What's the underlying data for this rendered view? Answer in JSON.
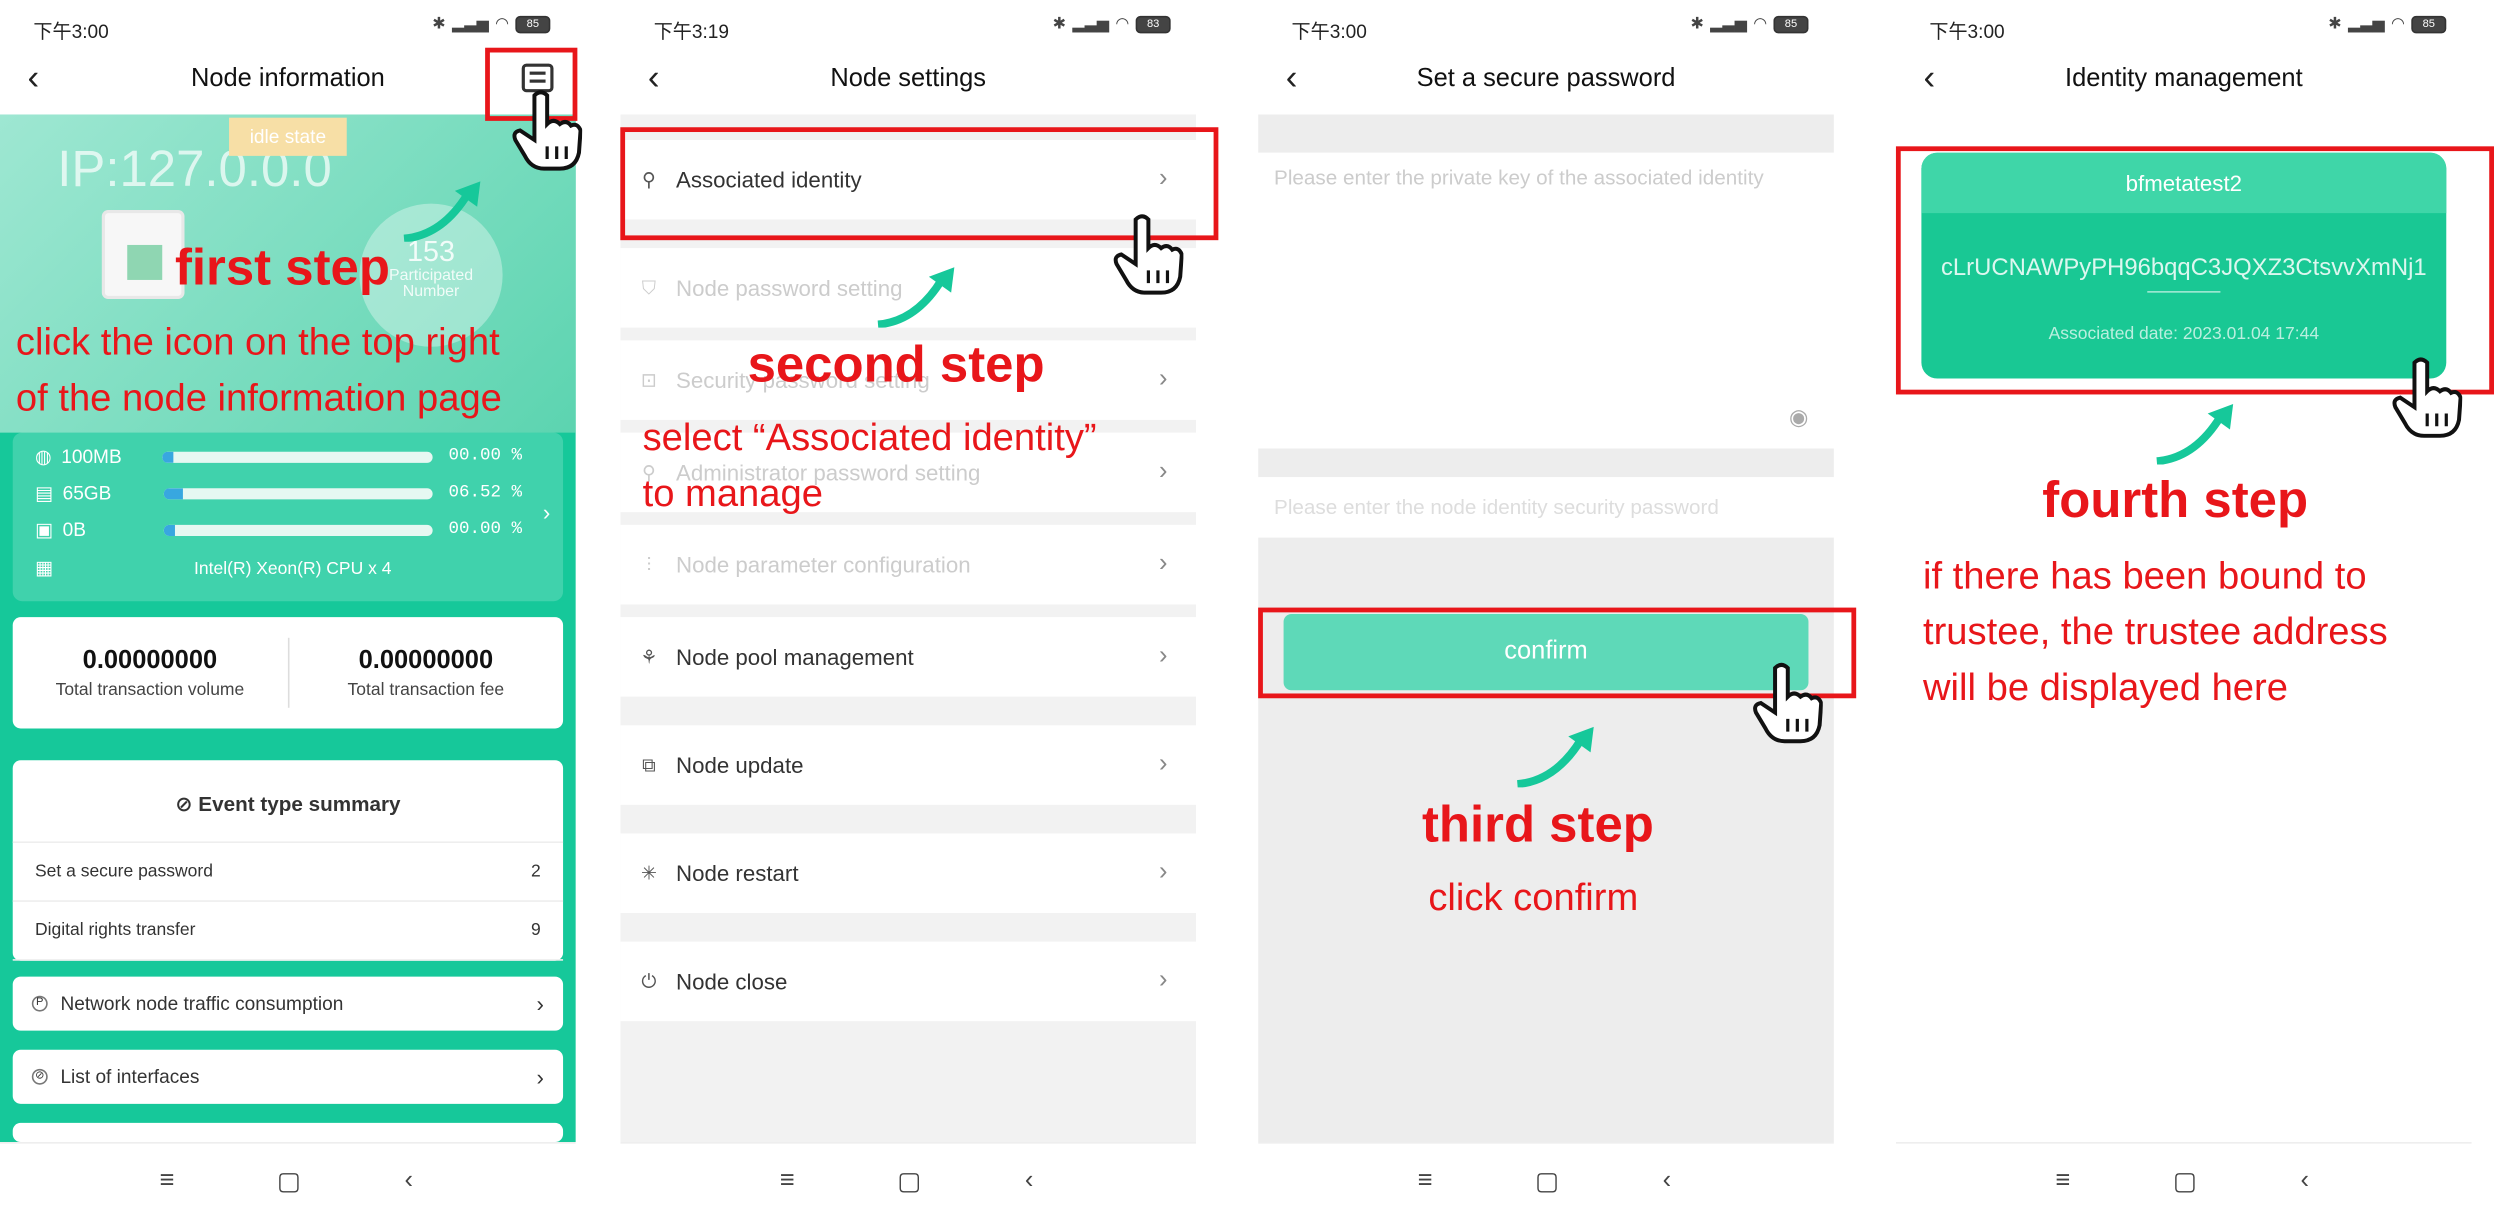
{
  "panels": [
    {
      "time": "下午3:00",
      "battery": "85",
      "title": "Node information"
    },
    {
      "time": "下午3:19",
      "battery": "83",
      "title": "Node settings"
    },
    {
      "time": "下午3:00",
      "battery": "85",
      "title": "Set a secure password"
    },
    {
      "time": "下午3:00",
      "battery": "85",
      "title": "Identity management"
    }
  ],
  "node_info": {
    "state_badge": "idle state",
    "ip": "IP:127.0.0.0",
    "participated_number": "153",
    "participated_label": "Participated Number",
    "resources": [
      {
        "icon": "globe-icon",
        "label": "100MB",
        "percent": "00.00 %",
        "fill": 0.04
      },
      {
        "icon": "disk-icon",
        "label": "65GB",
        "percent": "06.52 %",
        "fill": 0.07
      },
      {
        "icon": "memory-icon",
        "label": "0B",
        "percent": "00.00 %",
        "fill": 0.04
      }
    ],
    "cpu": "Intel(R) Xeon(R) CPU x 4",
    "total_tx_volume": "0.00000000",
    "total_tx_volume_label": "Total transaction volume",
    "total_tx_fee": "0.00000000",
    "total_tx_fee_label": "Total transaction fee",
    "event_summary_title": "Event type summary",
    "events": [
      {
        "name": "Set a secure password",
        "count": "2"
      },
      {
        "name": "Digital rights transfer",
        "count": "9"
      }
    ],
    "links": [
      "Network node traffic consumption",
      "List of interfaces"
    ]
  },
  "node_settings": {
    "items": [
      {
        "label": "Associated identity",
        "icon": "person-icon",
        "dim": false
      },
      {
        "label": "Node password setting",
        "icon": "shield-icon",
        "dim": true
      },
      {
        "label": "Security password setting",
        "icon": "lock-icon",
        "dim": true
      },
      {
        "label": "Administrator password setting",
        "icon": "admin-icon",
        "dim": true
      },
      {
        "label": "Node parameter configuration",
        "icon": "sliders-icon",
        "dim": true
      },
      {
        "label": "Node pool management",
        "icon": "pool-icon",
        "dim": false
      },
      {
        "label": "Node update",
        "icon": "update-icon",
        "dim": false
      },
      {
        "label": "Node restart",
        "icon": "restart-icon",
        "dim": false
      },
      {
        "label": "Node close",
        "icon": "power-icon",
        "dim": false
      }
    ]
  },
  "set_password": {
    "private_key_placeholder": "Please enter the private key of the associated identity",
    "security_password_placeholder": "Please enter the node identity security password",
    "confirm_label": "confirm"
  },
  "identity": {
    "name": "bfmetatest2",
    "address": "cLrUCNAWPyPH96bqqC3JQXZ3CtsvvXmNj1",
    "associated_date_label": "Associated date:",
    "associated_date": "2023.01.04 17:44"
  },
  "annotations": {
    "step1_title": "first step",
    "step1_line1": "click the icon on the top right",
    "step1_line2": "of the node information page",
    "step2_title": "second step",
    "step2_line1": "select “Associated identity”",
    "step2_line2": "to manage",
    "step3_title": "third step",
    "step3_line1": "click confirm",
    "step4_title": "fourth step",
    "step4_line1": "if there has been bound to",
    "step4_line2": "trustee, the trustee address",
    "step4_line3": "will be displayed here"
  },
  "colors": {
    "accent": "#16c89a",
    "annotation": "#e8161a",
    "confirm": "#5ed9b8"
  }
}
